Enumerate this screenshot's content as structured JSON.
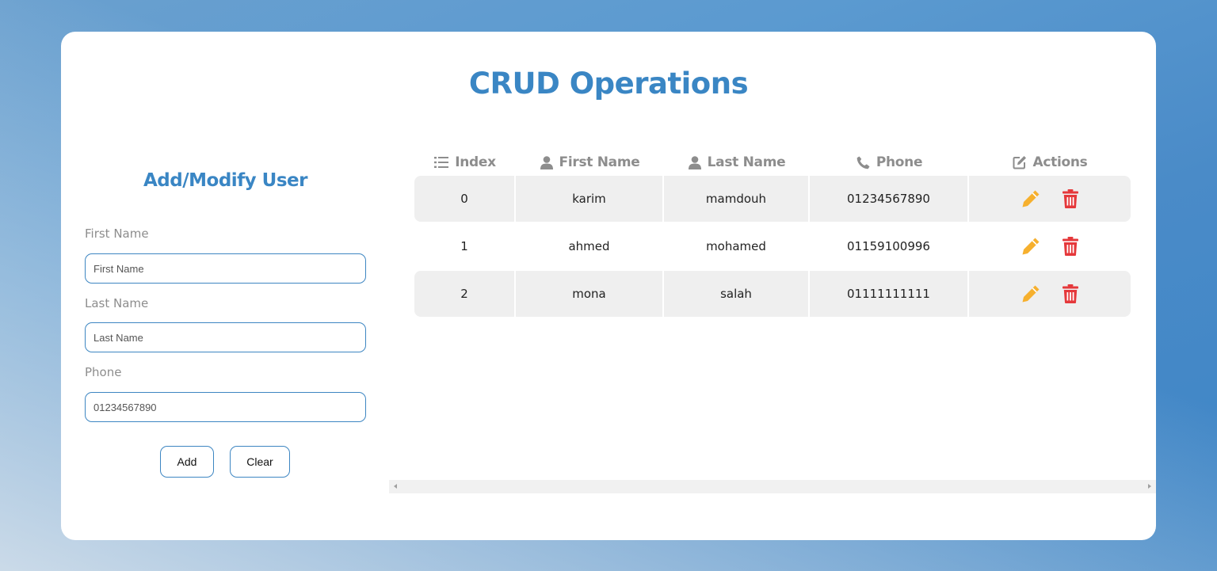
{
  "app": {
    "title": "CRUD Operations"
  },
  "form": {
    "title": "Add/Modify User",
    "first_name": {
      "label": "First Name",
      "placeholder": "First Name",
      "value": ""
    },
    "last_name": {
      "label": "Last Name",
      "placeholder": "Last Name",
      "value": ""
    },
    "phone": {
      "label": "Phone",
      "placeholder": "01234567890",
      "value": ""
    },
    "add_label": "Add",
    "clear_label": "Clear"
  },
  "table": {
    "headers": [
      {
        "label": "Index",
        "icon": "list-icon"
      },
      {
        "label": "First Name",
        "icon": "user-icon"
      },
      {
        "label": "Last Name",
        "icon": "user-icon"
      },
      {
        "label": "Phone",
        "icon": "phone-icon"
      },
      {
        "label": "Actions",
        "icon": "edit-square-icon"
      }
    ],
    "rows": [
      {
        "index": "0",
        "first": "karim",
        "last": "mamdouh",
        "phone": "01234567890"
      },
      {
        "index": "1",
        "first": "ahmed",
        "last": "mohamed",
        "phone": "01159100996"
      },
      {
        "index": "2",
        "first": "mona",
        "last": "salah",
        "phone": "01111111111"
      }
    ],
    "action_icons": {
      "edit": "pencil-icon",
      "delete": "trash-icon"
    }
  },
  "colors": {
    "accent": "#3a86c4",
    "edit": "#f6b02e",
    "delete": "#e5383b",
    "row_alt": "#efefef"
  }
}
